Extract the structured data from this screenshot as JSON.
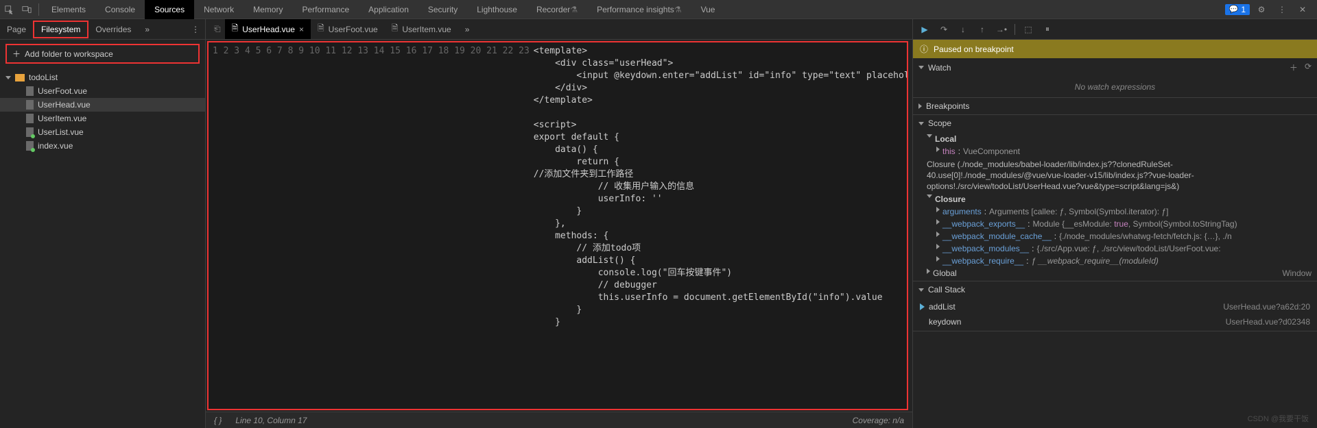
{
  "topTabs": [
    "Elements",
    "Console",
    "Sources",
    "Network",
    "Memory",
    "Performance",
    "Application",
    "Security",
    "Lighthouse",
    "Recorder",
    "Performance insights",
    "Vue"
  ],
  "topActive": "Sources",
  "msgCount": "1",
  "leftTabs": {
    "page": "Page",
    "filesystem": "Filesystem",
    "overrides": "Overrides"
  },
  "addFolder": "Add folder to workspace",
  "tree": {
    "root": "todoList",
    "files": [
      "UserFoot.vue",
      "UserHead.vue",
      "UserItem.vue",
      "UserList.vue",
      "index.vue"
    ],
    "selected": "UserHead.vue",
    "dotted": [
      "UserList.vue",
      "index.vue"
    ]
  },
  "editor": {
    "tabs": [
      {
        "n": "UserHead.vue",
        "active": true
      },
      {
        "n": "UserFoot.vue"
      },
      {
        "n": "UserItem.vue"
      }
    ],
    "lines": [
      "<template>",
      "    <div class=\"userHead\">",
      "        <input @keydown.enter=\"addList\" id=\"info\" type=\"text\" placeholder=\"",
      "    </div>",
      "</template>",
      "",
      "<script>",
      "export default {",
      "    data() {",
      "        return {",
      "//添加文件夹到工作路径",
      "            // 收集用户输入的信息",
      "            userInfo: ''",
      "        }",
      "    },",
      "    methods: {",
      "        // 添加todo项",
      "        addList() {",
      "            console.log(\"回车按键事件\")",
      "            // debugger",
      "            this.userInfo = document.getElementById(\"info\").value",
      "        }",
      "    }"
    ],
    "cursor": "Line 10, Column 17",
    "coverage": "Coverage: n/a"
  },
  "paused": "Paused on breakpoint",
  "watch": {
    "title": "Watch",
    "empty": "No watch expressions"
  },
  "bp": {
    "title": "Breakpoints"
  },
  "scope": {
    "title": "Scope",
    "local": "Local",
    "thisLbl": "this",
    "thisVal": "VueComponent",
    "closure1": "Closure (./node_modules/babel-loader/lib/index.js??clonedRuleSet-40.use[0]!./node_modules/@vue/vue-loader-v15/lib/index.js??vue-loader-options!./src/view/todoList/UserHead.vue?vue&type=script&lang=js&)",
    "closure2": "Closure",
    "args": {
      "k": "arguments",
      "v": "Arguments [callee: ƒ, Symbol(Symbol.iterator): ƒ]"
    },
    "we": {
      "k": "__webpack_exports__",
      "v": "Module {__esModule: true, Symbol(Symbol.toStringTag"
    },
    "wmc": {
      "k": "__webpack_module_cache__",
      "v": "{./node_modules/whatwg-fetch/fetch.js: {…}, ./n"
    },
    "wm": {
      "k": "__webpack_modules__",
      "v": "{./src/App.vue: ƒ, ./src/view/todoList/UserFoot.vue:"
    },
    "wr": {
      "k": "__webpack_require__",
      "v": "ƒ __webpack_require__(moduleId)"
    },
    "global": "Global",
    "globalVal": "Window"
  },
  "callstack": {
    "title": "Call Stack",
    "rows": [
      {
        "fn": "addList",
        "loc": "UserHead.vue?a62d:20"
      },
      {
        "fn": "keydown",
        "loc": "UserHead.vue?d02348"
      }
    ]
  },
  "watermark": "CSDN @我要干饭"
}
